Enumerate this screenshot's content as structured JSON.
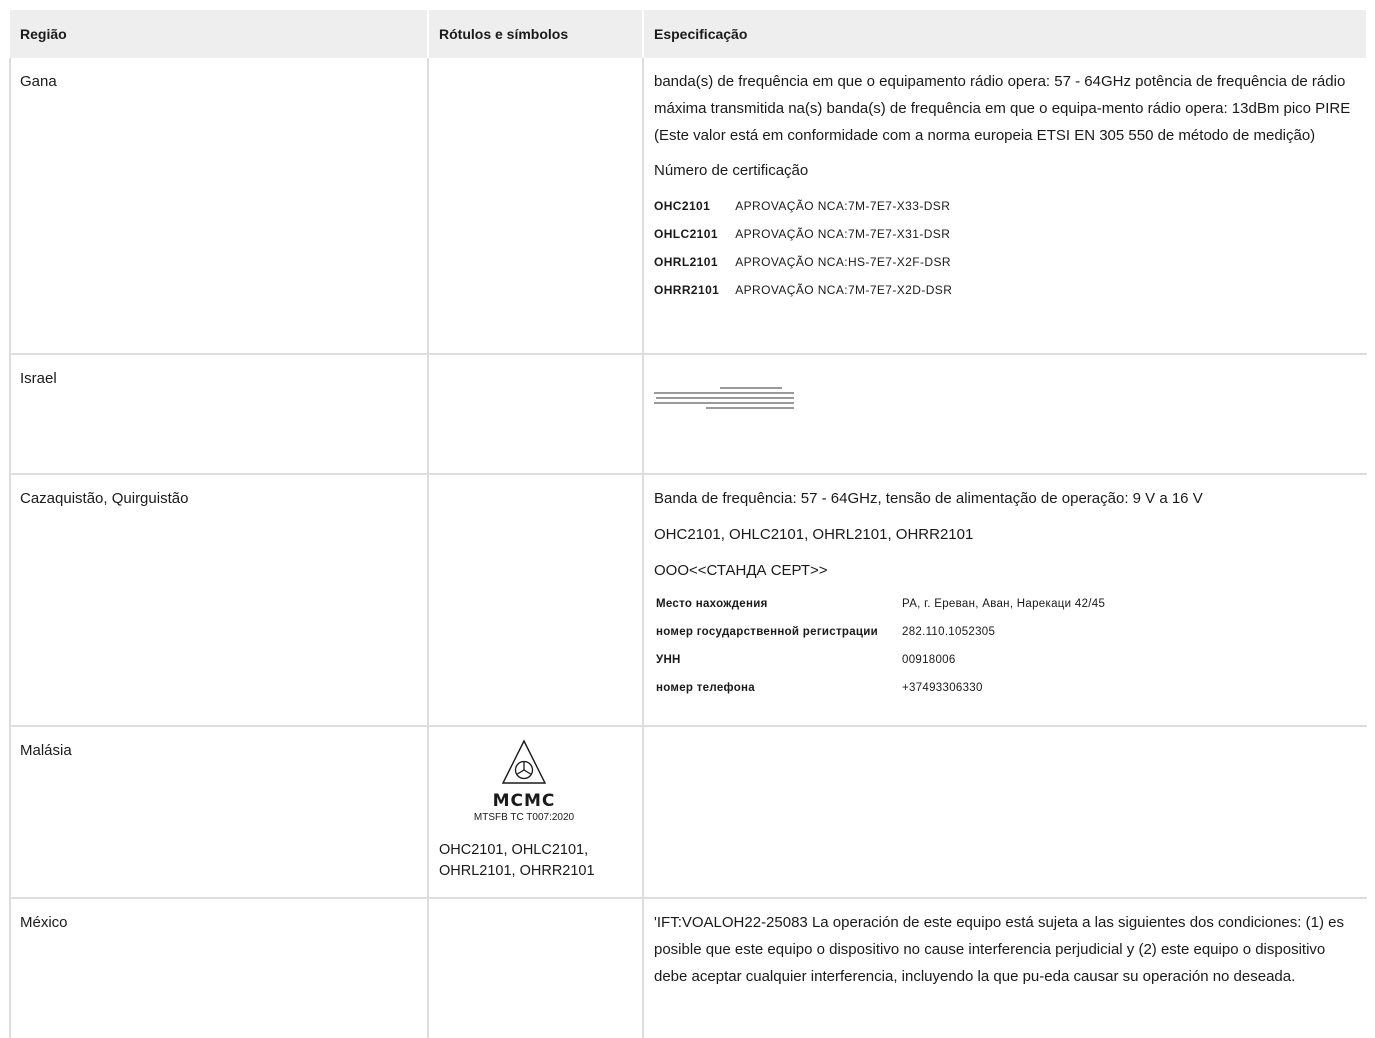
{
  "header": {
    "region": "Região",
    "labels": "Rótulos e símbolos",
    "spec": "Especificação"
  },
  "ghana": {
    "region": "Gana",
    "spec_text": "banda(s) de frequência em que o equipamento rádio opera: 57 - 64GHz potência de frequência de rádio máxima transmitida na(s) banda(s) de frequência em que o equipa-mento rádio opera: 13dBm pico PIRE (Este valor está em conformidade com a norma europeia ETSI EN 305 550 de método de medição)",
    "cert_title": "Número de certificação",
    "certs": [
      {
        "code": "OHC2101",
        "approval": "APROVAÇÃO NCA:7M-7E7-X33-DSR"
      },
      {
        "code": "OHLC2101",
        "approval": "APROVAÇÃO NCA:7M-7E7-X31-DSR"
      },
      {
        "code": "OHRL2101",
        "approval": "APROVAÇÃO NCA:HS-7E7-X2F-DSR"
      },
      {
        "code": "OHRR2101",
        "approval": "APROVAÇÃO NCA:7M-7E7-X2D-DSR"
      }
    ]
  },
  "israel": {
    "region": "Israel"
  },
  "kazakh": {
    "region": "Cazaquistão, Quirguistão",
    "spec_line1": "Banda de frequência: 57 - 64GHz, tensão de alimentação de operação: 9 V a 16 V",
    "spec_line2": "OHC2101, OHLC2101, OHRL2101, OHRR2101",
    "spec_line3": "ООО<<СТАНДА СЕРТ>>",
    "details": [
      {
        "key": "Место нахождения",
        "value": "РА, г. Ереван, Аван, Нарекаци   42/45"
      },
      {
        "key": "номер государственной регистрации",
        "value": "282.110.1052305"
      },
      {
        "key": "УНН",
        "value": "00918006"
      },
      {
        "key": "номер телефона",
        "value": "+37493306330"
      }
    ]
  },
  "malaysia": {
    "region": "Malásia",
    "logo_word": "MCMC",
    "logo_standard": "MTSFB TC T007:2020",
    "models": "OHC2101, OHLC2101, OHRL2101, OHRR2101"
  },
  "mexico": {
    "region": "México",
    "spec_text": "'IFT:VOALOH22-25083 La operación de este equipo está sujeta a las siguientes dos condiciones: (1) es posible que este equipo o dispositivo no cause interferencia perjudicial y (2) este equipo o dispositivo debe aceptar cualquier interferencia, incluyendo la que pu-eda causar su operación no deseada."
  }
}
